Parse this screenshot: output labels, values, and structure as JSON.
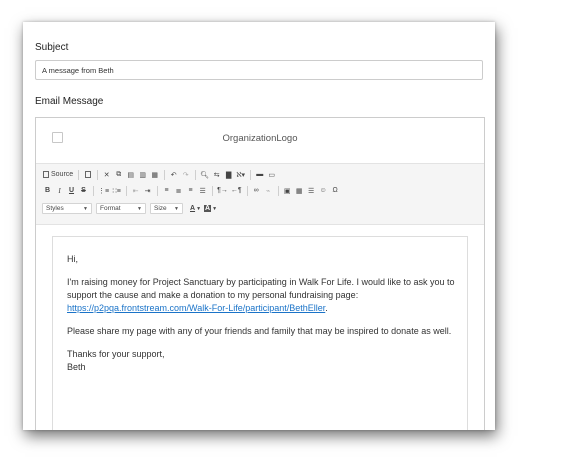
{
  "form": {
    "subject_label": "Subject",
    "subject_value": "A message from Beth",
    "email_message_label": "Email Message"
  },
  "editor": {
    "logo_text": "OrganizationLogo",
    "toolbar": {
      "source_label": "Source",
      "bold": "B",
      "italic": "I",
      "underline": "U",
      "strike": "S",
      "styles_label": "Styles",
      "format_label": "Format",
      "size_label": "Size",
      "font_color_label": "A",
      "bg_color_label": "A"
    },
    "message": {
      "greeting": "Hi,",
      "para1_text": "I'm raising money for Project Sanctuary by participating in Walk For Life. I would like to ask you to support the cause and make a donation to my personal fundraising page:",
      "link": "https://p2pqa.frontstream.com/Walk-For-Life/participant/BethEller",
      "para1_end": ".",
      "para2": "Please share my page with any of your friends and family that may be inspired to donate as well.",
      "closing": "Thanks for your support,",
      "signature": "Beth"
    }
  },
  "colors": {
    "link": "#1a73c8",
    "toolbar_bg": "#f5f5f5",
    "border": "#cccccc"
  }
}
